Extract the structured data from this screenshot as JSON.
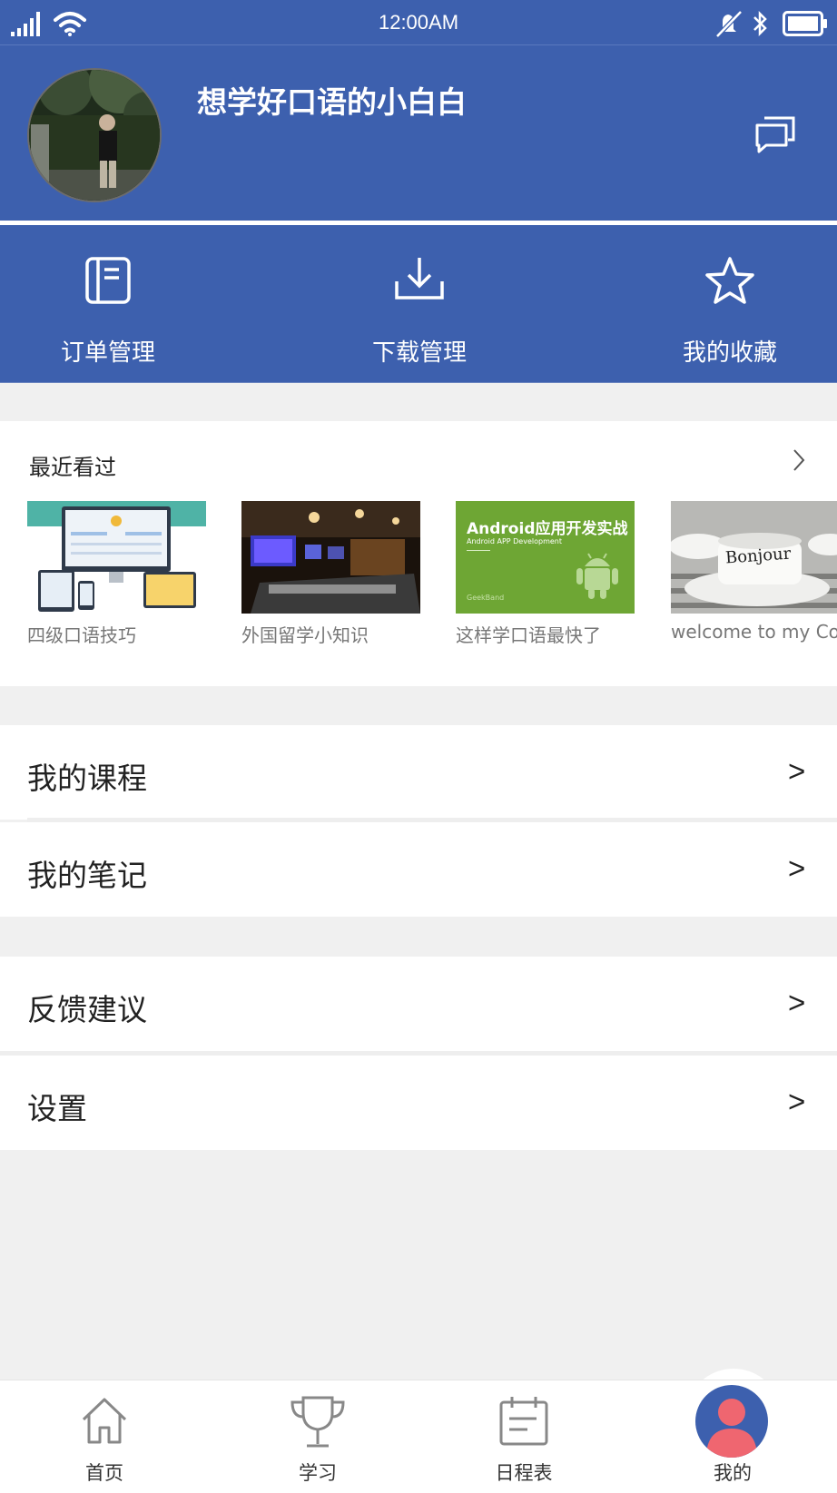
{
  "status_bar": {
    "time": "12:00AM"
  },
  "profile": {
    "username": "想学好口语的小白白"
  },
  "quick_actions": [
    {
      "label": "订单管理",
      "icon": "order-book-icon"
    },
    {
      "label": "下载管理",
      "icon": "download-icon"
    },
    {
      "label": "我的收藏",
      "icon": "star-icon"
    }
  ],
  "recent": {
    "title": "最近看过",
    "items": [
      {
        "caption": "四级口语技巧"
      },
      {
        "caption": "外国留学小知识"
      },
      {
        "caption": "这样学口语最快了",
        "thumb_title": "Android应用开发实战",
        "thumb_subtitle": "Android APP Development",
        "thumb_brand": "GeekBand"
      },
      {
        "caption": "welcome to my Cos",
        "thumb_text": "Bonjour"
      }
    ]
  },
  "menu": {
    "my_courses": "我的课程",
    "my_notes": "我的笔记",
    "feedback": "反馈建议",
    "settings": "设置",
    "arrow": ">"
  },
  "tabs": [
    {
      "label": "首页",
      "icon": "home-icon"
    },
    {
      "label": "学习",
      "icon": "trophy-icon"
    },
    {
      "label": "日程表",
      "icon": "calendar-icon"
    },
    {
      "label": "我的",
      "icon": "user-icon"
    }
  ],
  "colors": {
    "primary": "#3d60ae",
    "background": "#f0f0f0",
    "avatar_pink": "#ef6670",
    "android_green": "#6ea634"
  }
}
